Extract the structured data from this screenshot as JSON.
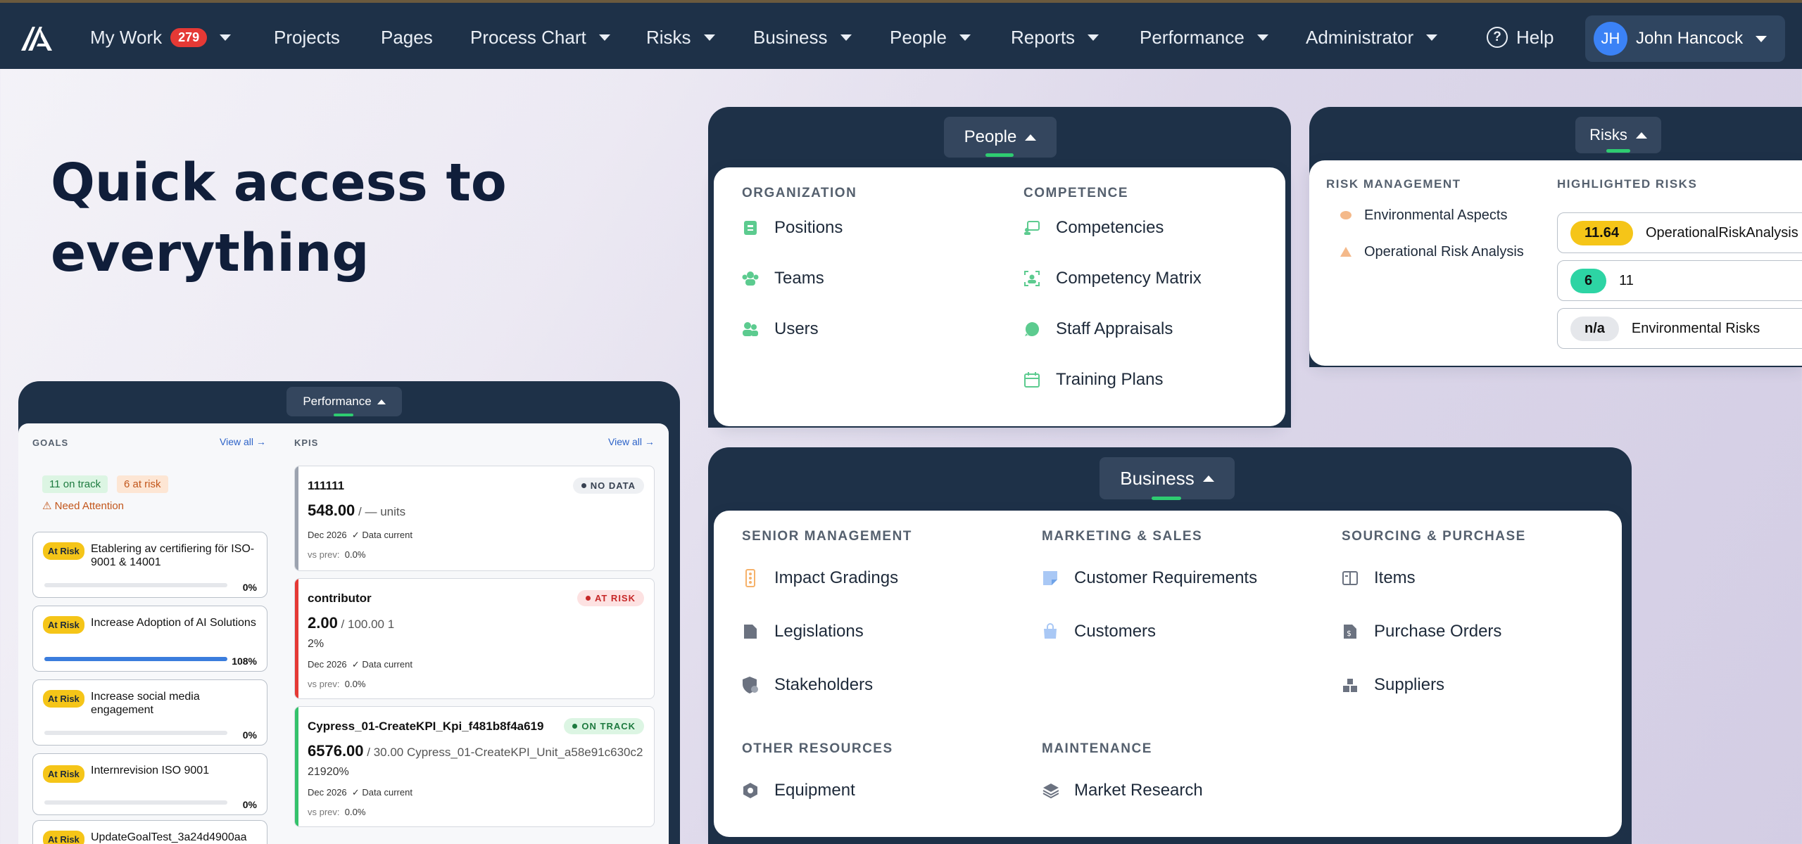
{
  "topnav": {
    "items": [
      {
        "label": "My Work",
        "badge": "279",
        "has_caret": true
      },
      {
        "label": "Projects"
      },
      {
        "label": "Pages"
      },
      {
        "label": "Process Chart",
        "has_caret": true
      },
      {
        "label": "Risks",
        "has_caret": true
      },
      {
        "label": "Business",
        "has_caret": true
      },
      {
        "label": "People",
        "has_caret": true
      },
      {
        "label": "Reports",
        "has_caret": true
      },
      {
        "label": "Performance",
        "has_caret": true
      },
      {
        "label": "Administrator",
        "has_caret": true
      }
    ],
    "help_label": "Help",
    "help_icon": "?",
    "user": {
      "initials": "JH",
      "name": "John Hancock"
    }
  },
  "headline": {
    "line1": "Quick access to",
    "line2": "everything"
  },
  "people_panel": {
    "pill": "People",
    "organization": {
      "title": "ORGANIZATION",
      "items": [
        "Positions",
        "Teams",
        "Users"
      ]
    },
    "competence": {
      "title": "COMPETENCE",
      "items": [
        "Competencies",
        "Competency Matrix",
        "Staff Appraisals",
        "Training Plans"
      ]
    }
  },
  "risks_panel": {
    "pill": "Risks",
    "risk_management": {
      "title": "RISK MANAGEMENT",
      "items": [
        "Environmental Aspects",
        "Operational Risk Analysis"
      ]
    },
    "highlighted": {
      "title": "HIGHLIGHTED RISKS",
      "rows": [
        {
          "score": "11.64",
          "name": "OperationalRiskAnalysis",
          "color": "#f5c518"
        },
        {
          "score": "6",
          "name": "11",
          "color": "#2dd4a4"
        },
        {
          "score": "n/a",
          "name": "Environmental Risks",
          "color": "#e5e7eb"
        }
      ]
    }
  },
  "business_panel": {
    "pill": "Business",
    "senior": {
      "title": "SENIOR MANAGEMENT",
      "items": [
        "Impact Gradings",
        "Legislations",
        "Stakeholders"
      ]
    },
    "marketing": {
      "title": "MARKETING & SALES",
      "items": [
        "Customer Requirements",
        "Customers"
      ]
    },
    "sourcing": {
      "title": "SOURCING & PURCHASE",
      "items": [
        "Items",
        "Purchase Orders",
        "Suppliers"
      ]
    },
    "other": {
      "title": "OTHER RESOURCES",
      "items": [
        "Equipment"
      ]
    },
    "maintenance": {
      "title": "MAINTENANCE",
      "items": [
        "Market Research"
      ]
    }
  },
  "performance_panel": {
    "pill": "Performance",
    "goals_title": "GOALS",
    "kpis_title": "KPIS",
    "view_all": "View all →",
    "on_track": "11 on track",
    "at_risk": "6 at risk",
    "need_attention": "⚠ Need Attention",
    "goals": [
      {
        "badge": "At Risk",
        "title": "Etablering av certifiering för ISO-9001 & 14001",
        "progress": 0,
        "pct": "0%"
      },
      {
        "badge": "At Risk",
        "title": "Increase Adoption of AI Solutions",
        "progress": 1.0,
        "pct": "108%"
      },
      {
        "badge": "At Risk",
        "title": "Increase social media engagement",
        "progress": 0,
        "pct": "0%"
      },
      {
        "badge": "At Risk",
        "title": "Internrevision ISO 9001",
        "progress": 0,
        "pct": "0%"
      },
      {
        "badge": "At Risk",
        "title": "UpdateGoalTest_3a24d4900aa",
        "progress": 0,
        "pct": ""
      }
    ],
    "kpis": [
      {
        "name": "111111",
        "status": "NO DATA",
        "value": "548.00",
        "rest": " / — units",
        "extra": "",
        "date": "Dec 2026",
        "check": "✓ Data current",
        "vs_label": "vs prev:",
        "vs": "0.0%"
      },
      {
        "name": "contributor",
        "status": "AT RISK",
        "value": "2.00",
        "rest": " / 100.00  1",
        "extra": "2%",
        "date": "Dec 2026",
        "check": "✓ Data current",
        "vs_label": "vs prev:",
        "vs": "0.0%"
      },
      {
        "name": "Cypress_01-CreateKPI_Kpi_f481b8f4a619",
        "status": "ON TRACK",
        "value": "6576.00",
        "rest": " / 30.00  Cypress_01-CreateKPI_Unit_a58e91c630c2",
        "extra": "21920%",
        "date": "Dec 2026",
        "check": "✓ Data current",
        "vs_label": "vs prev:",
        "vs": "0.0%"
      }
    ]
  }
}
